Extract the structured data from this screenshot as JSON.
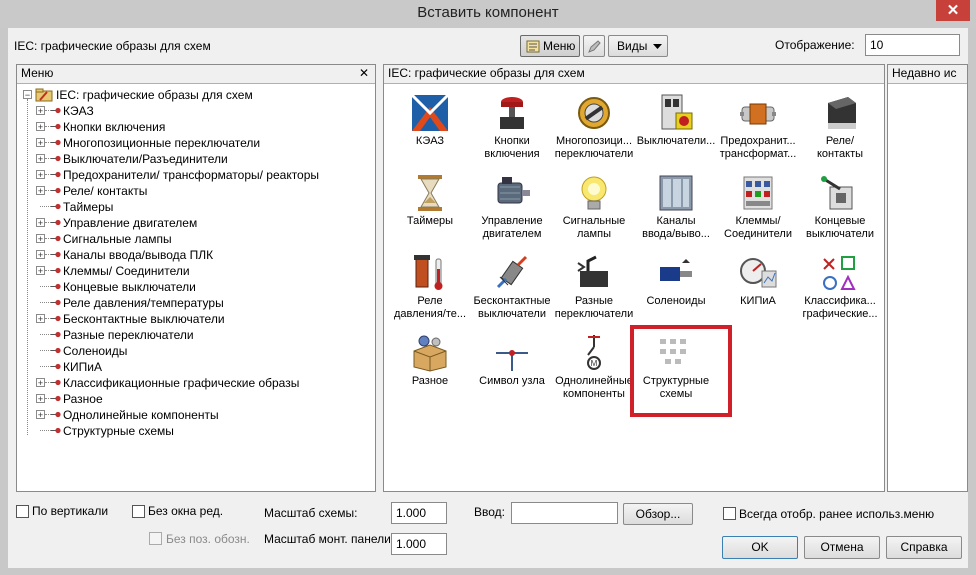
{
  "window": {
    "title": "Вставить компонент",
    "close_glyph": "✕"
  },
  "top": {
    "library_label": "IEC: графические образы для схем",
    "menu_button": "Меню",
    "views_button": "Виды",
    "display_label": "Отображение:",
    "display_value": "10"
  },
  "tree_panel": {
    "header": "Меню",
    "close_glyph": "✕",
    "root": "IEC: графические образы для схем",
    "items": [
      {
        "label": "КЭАЗ",
        "expandable": true
      },
      {
        "label": "Кнопки включения",
        "expandable": true
      },
      {
        "label": "Многопозиционные переключатели",
        "expandable": true
      },
      {
        "label": "Выключатели/Разъединители",
        "expandable": true
      },
      {
        "label": "Предохранители/ трансформаторы/ реакторы",
        "expandable": true
      },
      {
        "label": "Реле/ контакты",
        "expandable": true
      },
      {
        "label": "Таймеры",
        "expandable": false
      },
      {
        "label": "Управление двигателем",
        "expandable": true
      },
      {
        "label": "Сигнальные лампы",
        "expandable": true
      },
      {
        "label": "Каналы ввода/вывода ПЛК",
        "expandable": true
      },
      {
        "label": "Клеммы/ Соединители",
        "expandable": true
      },
      {
        "label": "Концевые выключатели",
        "expandable": false
      },
      {
        "label": "Реле давления/температуры",
        "expandable": false
      },
      {
        "label": "Бесконтактные выключатели",
        "expandable": true
      },
      {
        "label": "Разные переключатели",
        "expandable": false
      },
      {
        "label": "Соленоиды",
        "expandable": false
      },
      {
        "label": "КИПиА",
        "expandable": false
      },
      {
        "label": "Классификационные графические образы",
        "expandable": true
      },
      {
        "label": "Разное",
        "expandable": true
      },
      {
        "label": "Однолинейные компоненты",
        "expandable": true
      },
      {
        "label": "Структурные схемы",
        "expandable": false
      }
    ]
  },
  "icon_panel": {
    "header": "IEC: графические образы для схем",
    "tiles": [
      {
        "l1": "КЭАЗ",
        "l2": "",
        "icon": "keaz-logo-icon"
      },
      {
        "l1": "Кнопки",
        "l2": "включения",
        "icon": "pushbutton-icon"
      },
      {
        "l1": "Многопозици...",
        "l2": "переключатели",
        "icon": "selector-switch-icon"
      },
      {
        "l1": "Выключатели...",
        "l2": "",
        "icon": "disconnect-switch-icon"
      },
      {
        "l1": "Предохранит...",
        "l2": "трансформат...",
        "icon": "fuse-transformer-icon"
      },
      {
        "l1": "Реле/",
        "l2": "контакты",
        "icon": "relay-icon"
      },
      {
        "l1": "Таймеры",
        "l2": "",
        "icon": "hourglass-icon"
      },
      {
        "l1": "Управление",
        "l2": "двигателем",
        "icon": "motor-icon"
      },
      {
        "l1": "Сигнальные",
        "l2": "лампы",
        "icon": "lamp-icon"
      },
      {
        "l1": "Каналы",
        "l2": "ввода/выво...",
        "icon": "plc-io-icon"
      },
      {
        "l1": "Клеммы/",
        "l2": "Соединители",
        "icon": "terminal-icon"
      },
      {
        "l1": "Концевые",
        "l2": "выключатели",
        "icon": "limit-switch-icon"
      },
      {
        "l1": "Реле",
        "l2": "давления/те...",
        "icon": "pressure-temp-icon"
      },
      {
        "l1": "Бесконтактные",
        "l2": "выключатели",
        "icon": "proximity-switch-icon"
      },
      {
        "l1": "Разные",
        "l2": "переключатели",
        "icon": "misc-switch-icon"
      },
      {
        "l1": "Соленоиды",
        "l2": "",
        "icon": "solenoid-icon"
      },
      {
        "l1": "КИПиА",
        "l2": "",
        "icon": "gauge-icon"
      },
      {
        "l1": "Классифика...",
        "l2": "графические...",
        "icon": "shapes-icon"
      },
      {
        "l1": "Разное",
        "l2": "",
        "icon": "box-gears-icon"
      },
      {
        "l1": "Символ узла",
        "l2": "",
        "icon": "node-symbol-icon"
      },
      {
        "l1": "Однолинейные",
        "l2": "компоненты",
        "icon": "single-line-icon"
      },
      {
        "l1": "Структурные",
        "l2": "схемы",
        "icon": "block-diagram-icon"
      }
    ],
    "highlight_color": "#d0202a"
  },
  "recent_panel": {
    "header": "Недавно ис"
  },
  "bottom": {
    "vertical": "По вертикали",
    "no_edit": "Без окна ред.",
    "no_pos": "Без поз. обозн.",
    "scale_label": "Масштаб схемы:",
    "scale_value": "1.000",
    "panel_scale_label": "Масштаб монт. панели:",
    "panel_scale_value": "1.000",
    "input_label": "Ввод:",
    "input_value": "",
    "browse": "Обзор...",
    "always_show": "Всегда отобр. ранее использ.меню",
    "ok": "OK",
    "cancel": "Отмена",
    "help": "Справка"
  }
}
